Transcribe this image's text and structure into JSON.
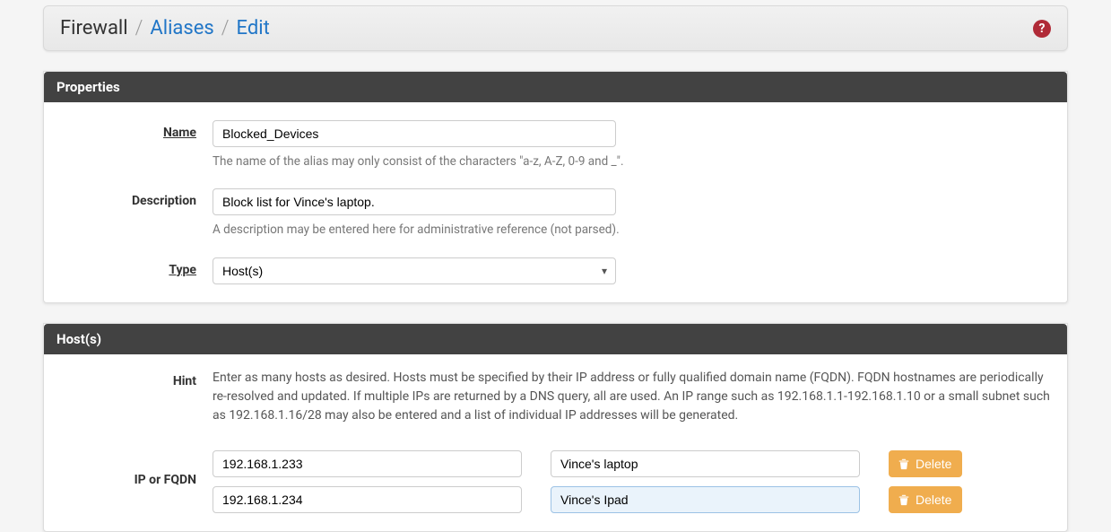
{
  "breadcrumb": {
    "root": "Firewall",
    "items": [
      "Aliases",
      "Edit"
    ]
  },
  "panels": {
    "properties": {
      "title": "Properties",
      "name": {
        "label": "Name",
        "value": "Blocked_Devices",
        "help": "The name of the alias may only consist of the characters \"a-z, A-Z, 0-9 and _\"."
      },
      "description": {
        "label": "Description",
        "value": "Block list for Vince's laptop.",
        "help": "A description may be entered here for administrative reference (not parsed)."
      },
      "type": {
        "label": "Type",
        "value": "Host(s)"
      }
    },
    "hosts": {
      "title": "Host(s)",
      "hint": {
        "label": "Hint",
        "text": "Enter as many hosts as desired. Hosts must be specified by their IP address or fully qualified domain name (FQDN). FQDN hostnames are periodically re-resolved and updated. If multiple IPs are returned by a DNS query, all are used. An IP range such as 192.168.1.1-192.168.1.10 or a small subnet such as 192.168.1.16/28 may also be entered and a list of individual IP addresses will be generated."
      },
      "row_label": "IP or FQDN",
      "delete_label": "Delete",
      "entries": [
        {
          "ip": "192.168.1.233",
          "desc": "Vince's laptop",
          "active": false
        },
        {
          "ip": "192.168.1.234",
          "desc": "Vince's Ipad",
          "active": true
        }
      ]
    }
  }
}
